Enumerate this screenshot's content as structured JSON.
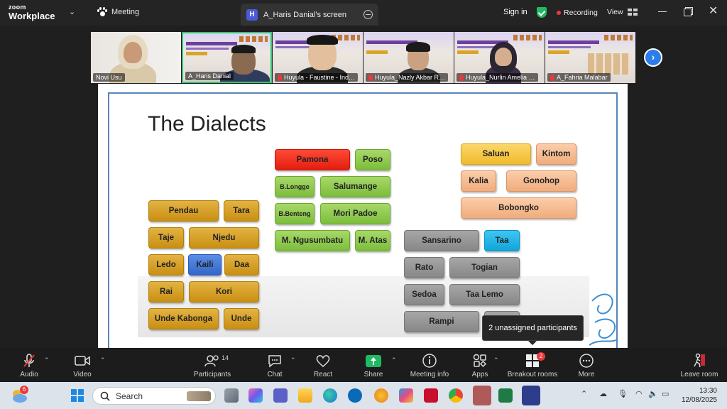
{
  "topbar": {
    "brand_top": "zoom",
    "brand_bottom": "Workplace",
    "meeting_label": "Meeting",
    "screen_tab_letter": "H",
    "screen_tab_title": "A_Haris Danial's screen",
    "signin": "Sign in",
    "recording": "Recording",
    "view": "View"
  },
  "gallery": [
    {
      "name": "Novi Usu",
      "muted": false
    },
    {
      "name": "A_Haris Danial",
      "muted": false,
      "active": true
    },
    {
      "name": "Huyula - Faustine - Ind…",
      "muted": true
    },
    {
      "name": "Huyula_Nazly Akbar R…",
      "muted": true
    },
    {
      "name": "Huyula_Nurlin Amelia …",
      "muted": true
    },
    {
      "name": "A_Fahria Malabar",
      "muted": true
    }
  ],
  "slide": {
    "title": "The Dialects",
    "boxes": [
      {
        "label": "Pamona",
        "color": "red"
      },
      {
        "label": "Poso",
        "color": "green"
      },
      {
        "label": "B.Longge",
        "color": "green"
      },
      {
        "label": "Salumange",
        "color": "green"
      },
      {
        "label": "B.Benteng",
        "color": "green"
      },
      {
        "label": "Mori Padoe",
        "color": "green"
      },
      {
        "label": "M. Ngusumbatu",
        "color": "green"
      },
      {
        "label": "M. Atas",
        "color": "green"
      },
      {
        "label": "Pendau",
        "color": "gold"
      },
      {
        "label": "Tara",
        "color": "gold"
      },
      {
        "label": "Taje",
        "color": "gold"
      },
      {
        "label": "Njedu",
        "color": "gold"
      },
      {
        "label": "Ledo",
        "color": "gold"
      },
      {
        "label": "Kaili",
        "color": "blue"
      },
      {
        "label": "Daa",
        "color": "gold"
      },
      {
        "label": "Rai",
        "color": "gold"
      },
      {
        "label": "Kori",
        "color": "gold"
      },
      {
        "label": "Unde Kabonga",
        "color": "gold"
      },
      {
        "label": "Unde",
        "color": "gold"
      },
      {
        "label": "Saluan",
        "color": "yellow"
      },
      {
        "label": "Kintom",
        "color": "peach"
      },
      {
        "label": "Kalia",
        "color": "peach"
      },
      {
        "label": "Gonohop",
        "color": "peach"
      },
      {
        "label": "Bobongko",
        "color": "peach"
      },
      {
        "label": "Sansarino",
        "color": "gray"
      },
      {
        "label": "Taa",
        "color": "cyan"
      },
      {
        "label": "Rato",
        "color": "gray"
      },
      {
        "label": "Togian",
        "color": "gray"
      },
      {
        "label": "Sedoa",
        "color": "gray"
      },
      {
        "label": "Taa Lemo",
        "color": "gray"
      },
      {
        "label": "Rampi",
        "color": "gray"
      }
    ]
  },
  "tooltip": "2 unassigned participants",
  "toolbar": {
    "audio": "Audio",
    "video": "Video",
    "participants": "Participants",
    "participants_count": "14",
    "chat": "Chat",
    "react": "React",
    "share": "Share",
    "meeting_info": "Meeting info",
    "apps": "Apps",
    "breakout": "Breakout rooms",
    "breakout_badge": "2",
    "more": "More",
    "leave": "Leave room"
  },
  "taskbar": {
    "weather_badge": "6",
    "search_placeholder": "Search",
    "time": "13:30",
    "date": "12/08/2025"
  },
  "colors": {
    "accent_green": "#35c275",
    "recording_red": "#e8393b",
    "next_blue": "#2b7de9",
    "share_green": "#1fba62"
  }
}
